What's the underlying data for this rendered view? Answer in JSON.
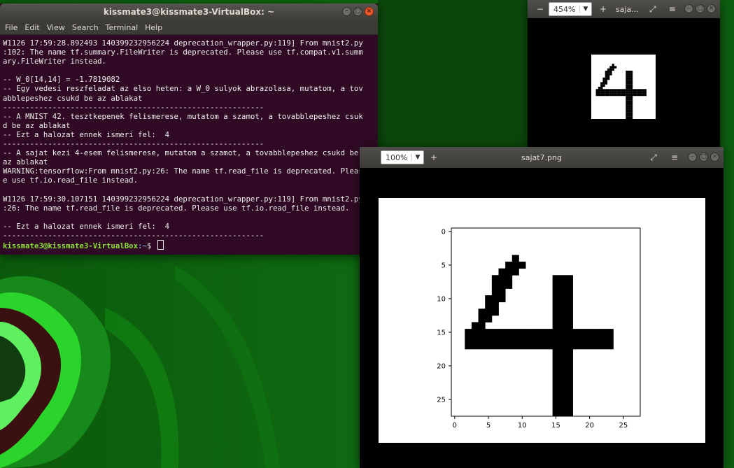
{
  "terminal": {
    "title": "kissmate3@kissmate3-VirtualBox: ~",
    "menu": [
      "File",
      "Edit",
      "View",
      "Search",
      "Terminal",
      "Help"
    ],
    "output": "W1126 17:59:28.892493 140399232956224 deprecation_wrapper.py:119] From mnist2.py\n:102: The name tf.summary.FileWriter is deprecated. Please use tf.compat.v1.summ\nary.FileWriter instead.\n\n-- W_0[14,14] = -1.7819082\n-- Egy vedesi reszfeladat az elso heten: a W_0 sulyok abrazolasa, mutatom, a tov\nabblepeshez csukd be az ablakat\n----------------------------------------------------------\n-- A MNIST 42. tesztkepenek felismerese, mutatom a szamot, a tovabblepeshez csuk\nd be az ablakat\n-- Ezt a halozat ennek ismeri fel:  4\n----------------------------------------------------------\n-- A sajat kezi 4-esem felismerese, mutatom a szamot, a tovabblepeshez csukd be\naz ablakat\nWARNING:tensorflow:From mnist2.py:26: The name tf.read_file is deprecated. Pleas\ne use tf.io.read_file instead.\n\nW1126 17:59:30.107151 140399232956224 deprecation_wrapper.py:119] From mnist2.py\n:26: The name tf.read_file is deprecated. Please use tf.io.read_file instead.\n\n-- Ezt a halozat ennek ismeri fel:  4\n----------------------------------------------------------",
    "prompt_user": "kissmate3@kissmate3-VirtualBox",
    "prompt_path": ":~",
    "prompt_symbol": "$ "
  },
  "viewer_small": {
    "zoom": "454%",
    "title": "saja..."
  },
  "viewer_big": {
    "zoom": "100%",
    "title": "sajat7.png"
  },
  "chart_data": {
    "type": "heatmap",
    "title": "",
    "x_ticks": [
      "0",
      "5",
      "10",
      "15",
      "20",
      "25"
    ],
    "y_ticks": [
      "0",
      "5",
      "10",
      "15",
      "20",
      "25"
    ],
    "xlim": [
      -0.5,
      27.5
    ],
    "ylim": [
      27.5,
      -0.5
    ],
    "colormap": "gray_r",
    "pixels": [
      [
        9,
        4,
        9,
        4
      ],
      [
        8,
        5,
        10,
        5
      ],
      [
        7,
        6,
        9,
        6
      ],
      [
        6,
        7,
        8,
        7
      ],
      [
        6,
        8,
        8,
        8
      ],
      [
        6,
        9,
        7,
        9
      ],
      [
        5,
        10,
        7,
        10
      ],
      [
        5,
        11,
        6,
        11
      ],
      [
        4,
        12,
        6,
        12
      ],
      [
        4,
        13,
        5,
        13
      ],
      [
        3,
        14,
        4,
        14
      ],
      [
        2,
        15,
        23,
        15
      ],
      [
        2,
        16,
        23,
        16
      ],
      [
        2,
        17,
        23,
        17
      ],
      [
        15,
        7,
        17,
        7
      ],
      [
        15,
        8,
        17,
        8
      ],
      [
        15,
        9,
        17,
        9
      ],
      [
        15,
        10,
        17,
        10
      ],
      [
        15,
        11,
        17,
        11
      ],
      [
        15,
        12,
        17,
        12
      ],
      [
        15,
        13,
        17,
        13
      ],
      [
        15,
        14,
        17,
        14
      ],
      [
        15,
        18,
        17,
        18
      ],
      [
        15,
        19,
        17,
        19
      ],
      [
        15,
        20,
        17,
        20
      ],
      [
        15,
        21,
        17,
        21
      ],
      [
        15,
        22,
        17,
        22
      ],
      [
        15,
        23,
        17,
        23
      ],
      [
        15,
        24,
        17,
        24
      ],
      [
        15,
        25,
        17,
        25
      ],
      [
        15,
        26,
        17,
        26
      ],
      [
        15,
        27,
        17,
        27
      ]
    ]
  }
}
